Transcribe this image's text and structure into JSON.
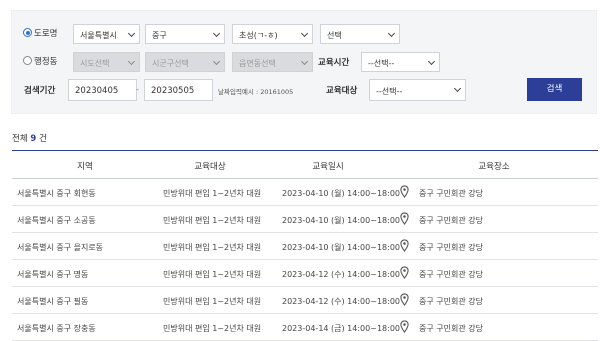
{
  "search": {
    "road": {
      "radio_label": "도로명",
      "city": "서울특별시",
      "district": "중구",
      "initial": "초성(ㄱ-ㅎ)",
      "road_select": "선택"
    },
    "admin": {
      "radio_label": "행정동",
      "sido": "시도선택",
      "sigungu": "시군구선택",
      "dong": "읍면동선택",
      "time_label": "교육시간",
      "time_select": "--선택--"
    },
    "period": {
      "label": "검색기간",
      "start": "20230405",
      "separator": "-",
      "end": "20230505",
      "hint": "날짜입력예시 : 20161005",
      "target_label": "교육대상",
      "target_select": "--선택--",
      "button": "검색"
    }
  },
  "summary": {
    "prefix": "전체",
    "count": "9",
    "suffix": "건"
  },
  "table": {
    "headers": [
      "지역",
      "교육대상",
      "교육일시",
      "교육장소"
    ],
    "rows": [
      {
        "region": "서울특별시 중구 회현동",
        "target": "민방위대 편입 1~2년차 대원",
        "datetime": "2023-04-10 (월) 14:00~18:00",
        "place": "중구 구민회관 강당"
      },
      {
        "region": "서울특별시 중구 소공동",
        "target": "민방위대 편입 1~2년차 대원",
        "datetime": "2023-04-10 (월) 14:00~18:00",
        "place": "중구 구민회관 강당"
      },
      {
        "region": "서울특별시 중구 을지로동",
        "target": "민방위대 편입 1~2년차 대원",
        "datetime": "2023-04-10 (월) 14:00~18:00",
        "place": "중구 구민회관 강당"
      },
      {
        "region": "서울특별시 중구 명동",
        "target": "민방위대 편입 1~2년차 대원",
        "datetime": "2023-04-12 (수) 14:00~18:00",
        "place": "중구 구민회관 강당"
      },
      {
        "region": "서울특별시 중구 필동",
        "target": "민방위대 편입 1~2년차 대원",
        "datetime": "2023-04-12 (수) 14:00~18:00",
        "place": "중구 구민회관 강당"
      },
      {
        "region": "서울특별시 중구 장충동",
        "target": "민방위대 편입 1~2년차 대원",
        "datetime": "2023-04-14 (금) 14:00~18:00",
        "place": "중구 구민회관 강당"
      }
    ]
  },
  "colors": {
    "accent": "#2d3e99",
    "radio": "#2f6fd6",
    "panel": "#f4f5f7"
  }
}
